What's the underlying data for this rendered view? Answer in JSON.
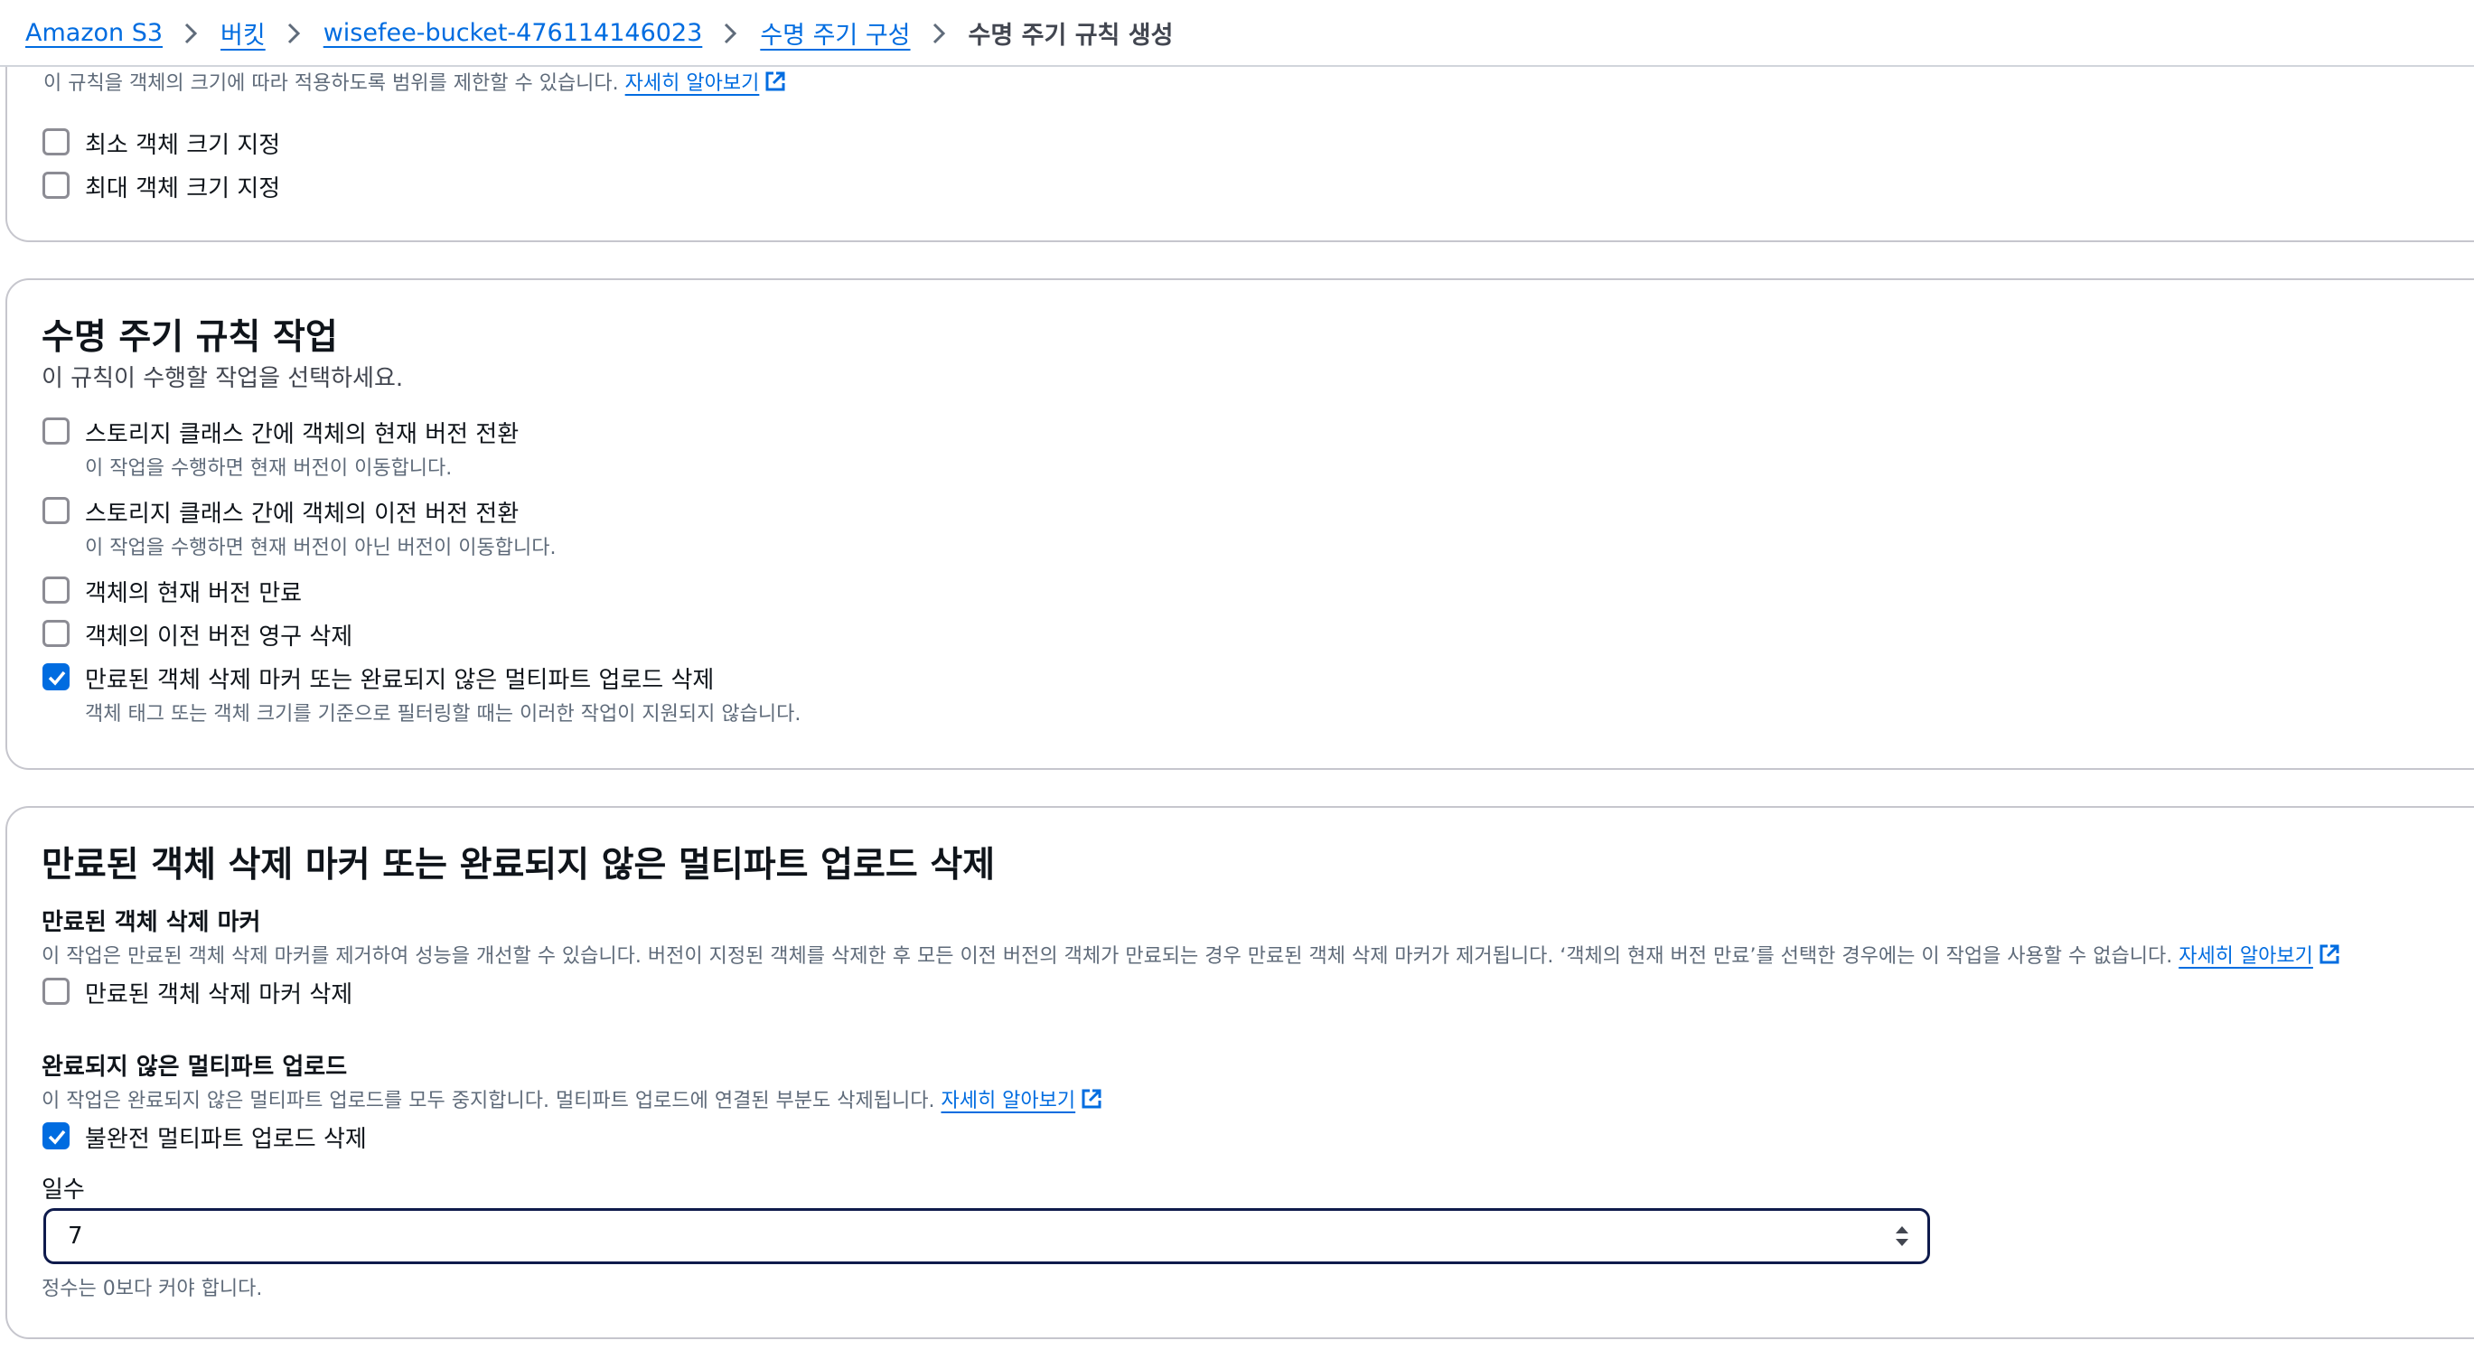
{
  "breadcrumb": {
    "items": [
      "Amazon S3",
      "버킷",
      "wisefee-bucket-476114146023",
      "수명 주기 구성"
    ],
    "current": "수명 주기 규칙 생성"
  },
  "filter_section": {
    "size_description": "이 규칙을 객체의 크기에 따라 적용하도록 범위를 제한할 수 있습니다.",
    "learn_more": "자세히 알아보기",
    "min_size_label": "최소 객체 크기 지정",
    "max_size_label": "최대 객체 크기 지정",
    "min_size_checked": false,
    "max_size_checked": false
  },
  "actions_section": {
    "title": "수명 주기 규칙 작업",
    "description": "이 규칙이 수행할 작업을 선택하세요.",
    "options": [
      {
        "label": "스토리지 클래스 간에 객체의 현재 버전 전환",
        "hint": "이 작업을 수행하면 현재 버전이 이동합니다.",
        "checked": false
      },
      {
        "label": "스토리지 클래스 간에 객체의 이전 버전 전환",
        "hint": "이 작업을 수행하면 현재 버전이 아닌 버전이 이동합니다.",
        "checked": false
      },
      {
        "label": "객체의 현재 버전 만료",
        "hint": "",
        "checked": false
      },
      {
        "label": "객체의 이전 버전 영구 삭제",
        "hint": "",
        "checked": false
      },
      {
        "label": "만료된 객체 삭제 마커 또는 완료되지 않은 멀티파트 업로드 삭제",
        "hint": "객체 태그 또는 객체 크기를 기준으로 필터링할 때는 이러한 작업이 지원되지 않습니다.",
        "checked": true
      }
    ]
  },
  "delete_section": {
    "title": "만료된 객체 삭제 마커 또는 완료되지 않은 멀티파트 업로드 삭제",
    "markers": {
      "heading": "만료된 객체 삭제 마커",
      "description": "이 작업은 만료된 객체 삭제 마커를 제거하여 성능을 개선할 수 있습니다. 버전이 지정된 객체를 삭제한 후 모든 이전 버전의 객체가 만료되는 경우 만료된 객체 삭제 마커가 제거됩니다. ‘객체의 현재 버전 만료’를 선택한 경우에는 이 작업을 사용할 수 없습니다.",
      "learn_more": "자세히 알아보기",
      "checkbox_label": "만료된 객체 삭제 마커 삭제",
      "checked": false
    },
    "multipart": {
      "heading": "완료되지 않은 멀티파트 업로드",
      "description": "이 작업은 완료되지 않은 멀티파트 업로드를 모두 중지합니다. 멀티파트 업로드에 연결된 부분도 삭제됩니다.",
      "learn_more": "자세히 알아보기",
      "checkbox_label": "불완전 멀티파트 업로드 삭제",
      "checked": true
    },
    "days": {
      "label": "일수",
      "value": "7",
      "hint": "정수는 0보다 커야 합니다."
    }
  },
  "colors": {
    "link": "#006ce0",
    "checkbox_checked": "#006ce0",
    "input_border_focus": "#0f1b4c"
  }
}
